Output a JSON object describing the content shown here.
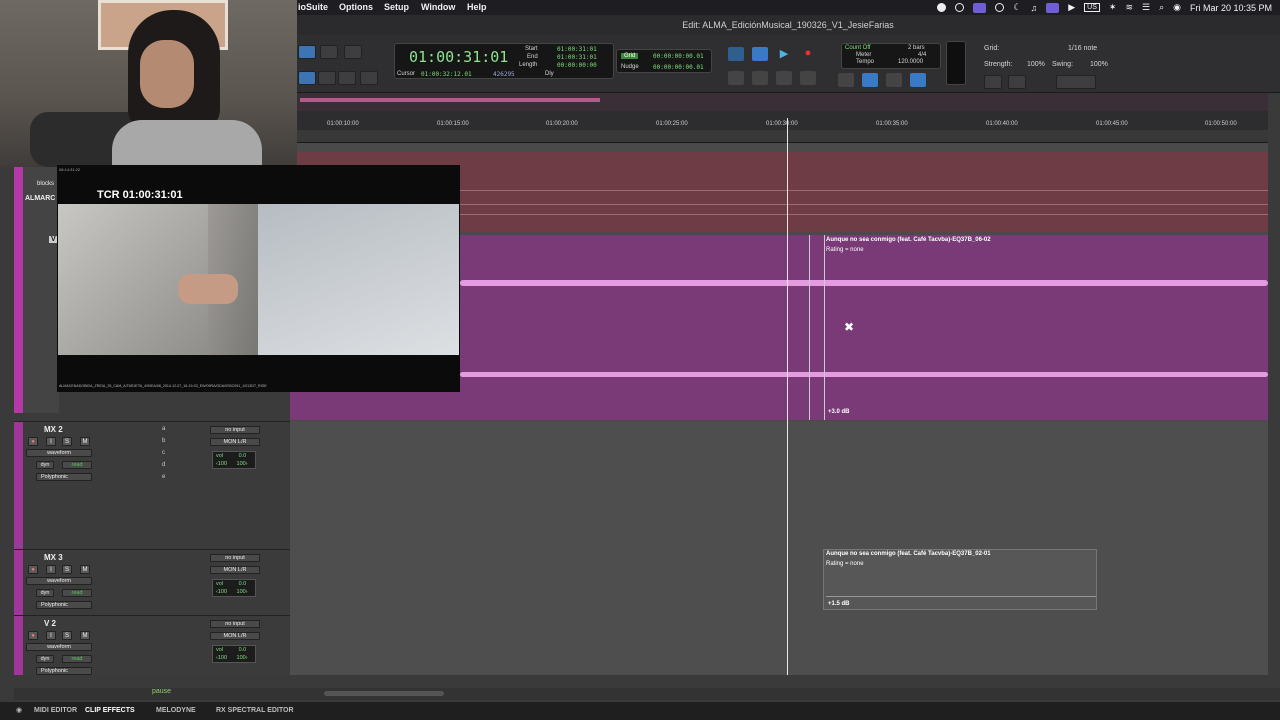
{
  "menubar": {
    "app": "ioSuite",
    "items": [
      "Options",
      "Setup",
      "Window",
      "Help"
    ],
    "right_status": [
      "US"
    ],
    "clock": "Fri Mar 20  10:35 PM"
  },
  "window": {
    "title": "Edit: ALMA_EdiciónMusical_190326_V1_JesieFarias"
  },
  "counter": {
    "main": "01:00:31:01",
    "start_label": "Start",
    "end_label": "End",
    "length_label": "Length",
    "start": "01:00:31:01",
    "end": "01:00:31:01",
    "length": "00:00:00:00",
    "cursor_label": "Cursor",
    "cursor": "01:00:32:12.01",
    "samples": "426295",
    "dly_label": "Dly"
  },
  "grid": {
    "grid_label": "Grid",
    "nudge_label": "Nudge",
    "grid_value": "00:00:00:00.01",
    "nudge_value": "00:00:00:00.01"
  },
  "tempo": {
    "count_off": "Count Off",
    "meter_label": "Meter",
    "tempo_label": "Tempo",
    "bars": "2 bars",
    "meter": "4/4",
    "tempo": "120.0000"
  },
  "gridpanel": {
    "grid_label": "Grid:",
    "grid_value": "1/16 note",
    "strength_label": "Strength:",
    "strength": "100%",
    "swing_label": "Swing:",
    "swing": "100%"
  },
  "ruler": {
    "ticks": [
      "01:00:10:00",
      "01:00:15:00",
      "01:00:20:00",
      "01:00:25:00",
      "01:00:30:00",
      "01:00:35:00",
      "01:00:40:00",
      "01:00:45:00",
      "01:00:50:00"
    ]
  },
  "clips": {
    "pink": {
      "title": "Aunque no sea conmigo (feat. Café Tacvba)-EQ37B_06-02",
      "rating": "Rating = none",
      "gain": "+3.0 dB"
    },
    "gray": {
      "title": "Aunque no sea conmigo (feat. Café Tacvba)-EQ37B_02-01",
      "rating": "Rating = none",
      "gain": "+1.5 dB"
    }
  },
  "video": {
    "tcr": "TCR 01:00:31:01",
    "top_label": "08:14:31:22",
    "bottom_label": "ALMACENADOBIDA_ZRIDA_25_CAM_A/TARJETA_4/90EA/08_2014-12-07_16-19-03_EW/09RA/GDA/0S0C091_1/013DT_RIGE"
  },
  "tracks": {
    "blocks": "blocks",
    "almar": "ALMARC",
    "v": "V",
    "list": [
      {
        "name": "MX 2",
        "input": "no input",
        "output": "MON L/R",
        "vol": "0.0",
        "pan_l": "‹100",
        "pan_r": "100›",
        "view": "waveform",
        "dyn": "dyn",
        "mode": "read",
        "plugin": "Polyphonic"
      },
      {
        "name": "MX 3",
        "input": "no input",
        "output": "MON L/R",
        "vol": "0.0",
        "pan_l": "‹100",
        "pan_r": "100›",
        "view": "waveform",
        "dyn": "dyn",
        "mode": "read",
        "plugin": "Polyphonic"
      },
      {
        "name": "V 2",
        "input": "no input",
        "output": "MON L/R",
        "vol": "0.0",
        "pan_l": "‹100",
        "pan_r": "100›",
        "view": "waveform",
        "dyn": "dyn",
        "mode": "read",
        "plugin": "Polyphonic"
      }
    ],
    "vol_label": "vol",
    "buttons": {
      "rec": "●",
      "i": "I",
      "s": "S",
      "m": "M"
    },
    "inserts": [
      "a",
      "b",
      "c",
      "d",
      "e"
    ],
    "status": "pause"
  },
  "bottom_tabs": [
    "MIDI EDITOR",
    "CLIP EFFECTS",
    "MELODYNE",
    "RX SPECTRAL EDITOR"
  ],
  "colors": {
    "track_pink": "#7a3a77",
    "track_red": "#6e3c44",
    "accent_magenta": "#b33aa6",
    "counter_green": "#8fe38f"
  }
}
